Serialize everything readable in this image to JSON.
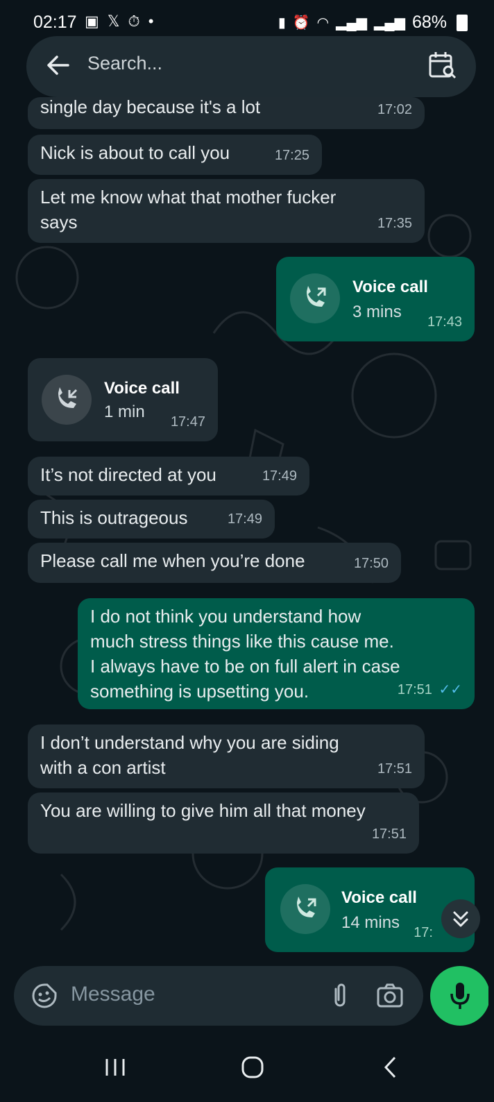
{
  "status": {
    "time": "02:17",
    "battery": "68%"
  },
  "search": {
    "placeholder": "Search..."
  },
  "messages": [
    {
      "dir": "in",
      "text": "single day because it's a lot",
      "time": "17:02"
    },
    {
      "dir": "in",
      "text": "Nick is about to call you",
      "time": "17:25"
    },
    {
      "dir": "in",
      "lines": [
        "Let me know what that mother fucker",
        "says"
      ],
      "time": "17:35"
    },
    {
      "dir": "out",
      "type": "call",
      "title": "Voice call",
      "duration": "3 mins",
      "time": "17:43"
    },
    {
      "dir": "in",
      "type": "call",
      "title": "Voice call",
      "duration": "1 min",
      "time": "17:47"
    },
    {
      "dir": "in",
      "text": "It’s not directed at you",
      "time": "17:49"
    },
    {
      "dir": "in",
      "text": "This is outrageous",
      "time": "17:49"
    },
    {
      "dir": "in",
      "text": "Please call me when you’re done",
      "time": "17:50"
    },
    {
      "dir": "out",
      "lines": [
        "I do not think you understand how",
        "much stress things like this cause me.",
        "I always have to be on full alert in case",
        "something is upsetting you."
      ],
      "time": "17:51"
    },
    {
      "dir": "in",
      "lines": [
        "I don’t understand why you are siding",
        "with a con artist"
      ],
      "time": "17:51"
    },
    {
      "dir": "in",
      "text": "You are willing to give him all that money",
      "time": "17:51"
    },
    {
      "dir": "out",
      "type": "call",
      "title": "Voice call",
      "duration": "14 mins",
      "time": "17:"
    }
  ],
  "composer": {
    "placeholder": "Message"
  },
  "colors": {
    "background": "#0b141a",
    "incoming": "#202c33",
    "outgoing": "#005c4b",
    "accent": "#21c063",
    "read_ticks": "#53bdeb"
  }
}
